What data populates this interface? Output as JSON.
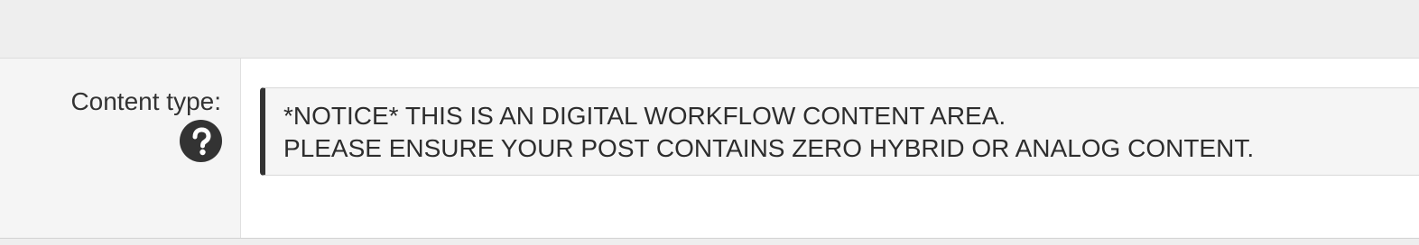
{
  "field": {
    "label": "Content type:",
    "help_icon": "question-circle-icon"
  },
  "notice": {
    "line1": "*NOTICE* THIS IS AN DIGITAL WORKFLOW CONTENT AREA.",
    "line2": "PLEASE ENSURE YOUR POST CONTAINS ZERO HYBRID OR ANALOG CONTENT."
  },
  "colors": {
    "background": "#eeeeee",
    "label_cell": "#f5f5f5",
    "notice_bg": "#f5f5f5",
    "notice_accent": "#333333",
    "text": "#333333"
  }
}
